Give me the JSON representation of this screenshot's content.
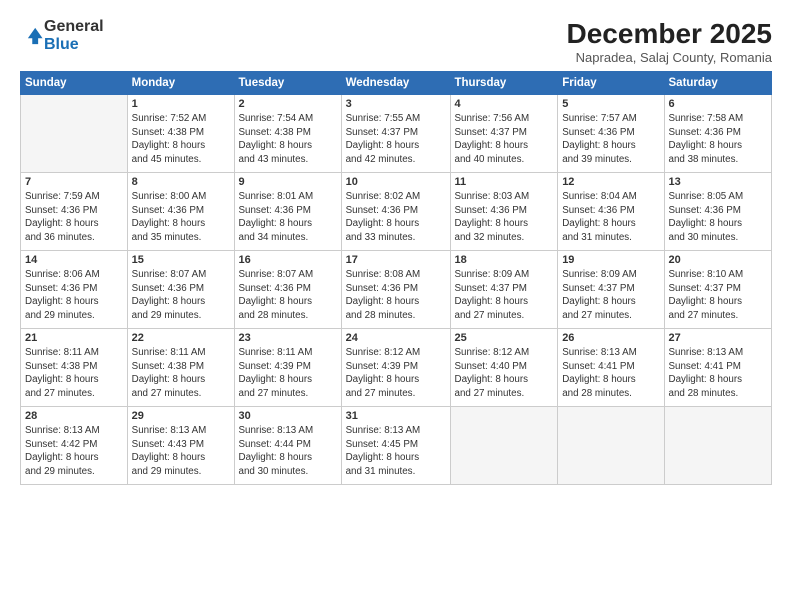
{
  "logo": {
    "general": "General",
    "blue": "Blue"
  },
  "title": "December 2025",
  "subtitle": "Napradea, Salaj County, Romania",
  "headers": [
    "Sunday",
    "Monday",
    "Tuesday",
    "Wednesday",
    "Thursday",
    "Friday",
    "Saturday"
  ],
  "weeks": [
    [
      {
        "num": "",
        "detail": ""
      },
      {
        "num": "1",
        "detail": "Sunrise: 7:52 AM\nSunset: 4:38 PM\nDaylight: 8 hours\nand 45 minutes."
      },
      {
        "num": "2",
        "detail": "Sunrise: 7:54 AM\nSunset: 4:38 PM\nDaylight: 8 hours\nand 43 minutes."
      },
      {
        "num": "3",
        "detail": "Sunrise: 7:55 AM\nSunset: 4:37 PM\nDaylight: 8 hours\nand 42 minutes."
      },
      {
        "num": "4",
        "detail": "Sunrise: 7:56 AM\nSunset: 4:37 PM\nDaylight: 8 hours\nand 40 minutes."
      },
      {
        "num": "5",
        "detail": "Sunrise: 7:57 AM\nSunset: 4:36 PM\nDaylight: 8 hours\nand 39 minutes."
      },
      {
        "num": "6",
        "detail": "Sunrise: 7:58 AM\nSunset: 4:36 PM\nDaylight: 8 hours\nand 38 minutes."
      }
    ],
    [
      {
        "num": "7",
        "detail": "Sunrise: 7:59 AM\nSunset: 4:36 PM\nDaylight: 8 hours\nand 36 minutes."
      },
      {
        "num": "8",
        "detail": "Sunrise: 8:00 AM\nSunset: 4:36 PM\nDaylight: 8 hours\nand 35 minutes."
      },
      {
        "num": "9",
        "detail": "Sunrise: 8:01 AM\nSunset: 4:36 PM\nDaylight: 8 hours\nand 34 minutes."
      },
      {
        "num": "10",
        "detail": "Sunrise: 8:02 AM\nSunset: 4:36 PM\nDaylight: 8 hours\nand 33 minutes."
      },
      {
        "num": "11",
        "detail": "Sunrise: 8:03 AM\nSunset: 4:36 PM\nDaylight: 8 hours\nand 32 minutes."
      },
      {
        "num": "12",
        "detail": "Sunrise: 8:04 AM\nSunset: 4:36 PM\nDaylight: 8 hours\nand 31 minutes."
      },
      {
        "num": "13",
        "detail": "Sunrise: 8:05 AM\nSunset: 4:36 PM\nDaylight: 8 hours\nand 30 minutes."
      }
    ],
    [
      {
        "num": "14",
        "detail": "Sunrise: 8:06 AM\nSunset: 4:36 PM\nDaylight: 8 hours\nand 29 minutes."
      },
      {
        "num": "15",
        "detail": "Sunrise: 8:07 AM\nSunset: 4:36 PM\nDaylight: 8 hours\nand 29 minutes."
      },
      {
        "num": "16",
        "detail": "Sunrise: 8:07 AM\nSunset: 4:36 PM\nDaylight: 8 hours\nand 28 minutes."
      },
      {
        "num": "17",
        "detail": "Sunrise: 8:08 AM\nSunset: 4:36 PM\nDaylight: 8 hours\nand 28 minutes."
      },
      {
        "num": "18",
        "detail": "Sunrise: 8:09 AM\nSunset: 4:37 PM\nDaylight: 8 hours\nand 27 minutes."
      },
      {
        "num": "19",
        "detail": "Sunrise: 8:09 AM\nSunset: 4:37 PM\nDaylight: 8 hours\nand 27 minutes."
      },
      {
        "num": "20",
        "detail": "Sunrise: 8:10 AM\nSunset: 4:37 PM\nDaylight: 8 hours\nand 27 minutes."
      }
    ],
    [
      {
        "num": "21",
        "detail": "Sunrise: 8:11 AM\nSunset: 4:38 PM\nDaylight: 8 hours\nand 27 minutes."
      },
      {
        "num": "22",
        "detail": "Sunrise: 8:11 AM\nSunset: 4:38 PM\nDaylight: 8 hours\nand 27 minutes."
      },
      {
        "num": "23",
        "detail": "Sunrise: 8:11 AM\nSunset: 4:39 PM\nDaylight: 8 hours\nand 27 minutes."
      },
      {
        "num": "24",
        "detail": "Sunrise: 8:12 AM\nSunset: 4:39 PM\nDaylight: 8 hours\nand 27 minutes."
      },
      {
        "num": "25",
        "detail": "Sunrise: 8:12 AM\nSunset: 4:40 PM\nDaylight: 8 hours\nand 27 minutes."
      },
      {
        "num": "26",
        "detail": "Sunrise: 8:13 AM\nSunset: 4:41 PM\nDaylight: 8 hours\nand 28 minutes."
      },
      {
        "num": "27",
        "detail": "Sunrise: 8:13 AM\nSunset: 4:41 PM\nDaylight: 8 hours\nand 28 minutes."
      }
    ],
    [
      {
        "num": "28",
        "detail": "Sunrise: 8:13 AM\nSunset: 4:42 PM\nDaylight: 8 hours\nand 29 minutes."
      },
      {
        "num": "29",
        "detail": "Sunrise: 8:13 AM\nSunset: 4:43 PM\nDaylight: 8 hours\nand 29 minutes."
      },
      {
        "num": "30",
        "detail": "Sunrise: 8:13 AM\nSunset: 4:44 PM\nDaylight: 8 hours\nand 30 minutes."
      },
      {
        "num": "31",
        "detail": "Sunrise: 8:13 AM\nSunset: 4:45 PM\nDaylight: 8 hours\nand 31 minutes."
      },
      {
        "num": "",
        "detail": ""
      },
      {
        "num": "",
        "detail": ""
      },
      {
        "num": "",
        "detail": ""
      }
    ]
  ]
}
